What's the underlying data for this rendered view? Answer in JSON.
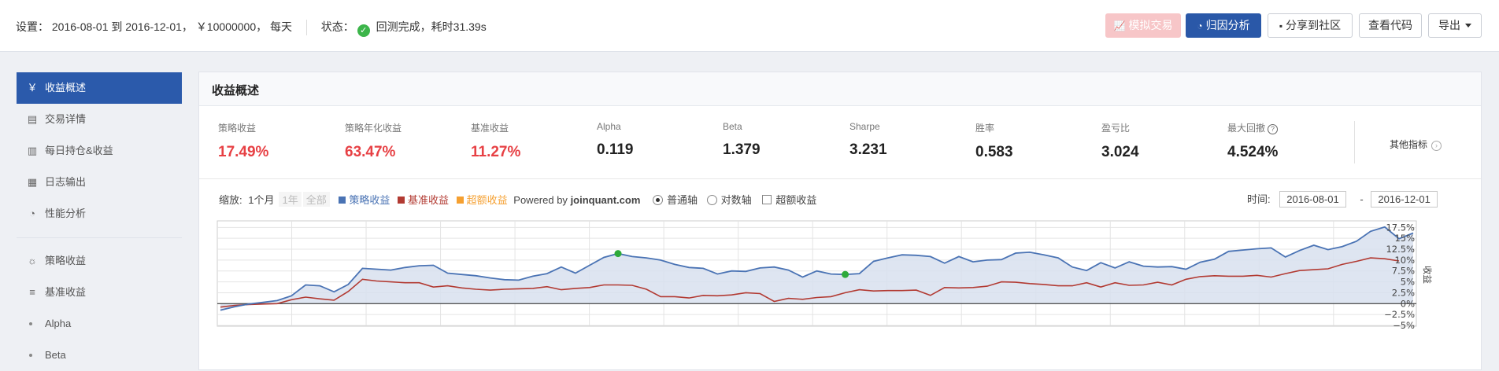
{
  "header": {
    "settings_label": "设置：",
    "start_date": "2016-08-01",
    "to_text": "到",
    "end_date": "2016-12-01",
    "capital": "￥10000000",
    "frequency": "每天",
    "status_label": "状态：",
    "status_text": "回测完成，耗时31.39s",
    "buttons": {
      "simulate": "模拟交易",
      "attribution": "归因分析",
      "share": "分享到社区",
      "view_code": "查看代码",
      "export": "导出"
    }
  },
  "sidebar": {
    "items": [
      {
        "label": "收益概述",
        "icon": "yen-icon"
      },
      {
        "label": "交易详情",
        "icon": "document-icon"
      },
      {
        "label": "每日持仓&收益",
        "icon": "bar-chart-icon"
      },
      {
        "label": "日志输出",
        "icon": "calendar-icon"
      },
      {
        "label": "性能分析",
        "icon": "pie-chart-icon"
      },
      {
        "label": "策略收益",
        "icon": "lightbulb-icon"
      },
      {
        "label": "基准收益",
        "icon": "database-icon"
      },
      {
        "label": "Alpha"
      },
      {
        "label": "Beta"
      }
    ]
  },
  "main": {
    "title": "收益概述",
    "metrics": [
      {
        "label": "策略收益",
        "value": "17.49%"
      },
      {
        "label": "策略年化收益",
        "value": "63.47%"
      },
      {
        "label": "基准收益",
        "value": "11.27%"
      },
      {
        "label": "Alpha",
        "value": "0.119"
      },
      {
        "label": "Beta",
        "value": "1.379"
      },
      {
        "label": "Sharpe",
        "value": "3.231"
      },
      {
        "label": "胜率",
        "value": "0.583"
      },
      {
        "label": "盈亏比",
        "value": "3.024"
      },
      {
        "label": "最大回撤",
        "value": "4.524%",
        "help": "?"
      }
    ],
    "other_metrics": "其他指标",
    "controls": {
      "zoom_label": "缩放:",
      "zoom_options": [
        "1个月",
        "1年",
        "全部"
      ],
      "legend": [
        "策略收益",
        "基准收益",
        "超额收益"
      ],
      "powered_by": "Powered by",
      "brand": "joinquant.com",
      "axis_options": [
        "普通轴",
        "对数轴"
      ],
      "excess_checkbox": "超额收益",
      "time_label": "时间:",
      "date_from": "2016-08-01",
      "date_sep": "-",
      "date_to": "2016-12-01"
    },
    "colors": {
      "strategy": "#4a73b4",
      "benchmark": "#b23a32",
      "excess": "#f5a031",
      "area": "#d8e0ee",
      "accent": "#2b5aab",
      "positive": "#e74044"
    }
  },
  "chart_data": {
    "type": "line",
    "y_axis_side": "right",
    "ylabel": "收益",
    "ylim": [
      -5,
      19
    ],
    "y_ticks": [
      "17.5%",
      "15%",
      "12.5%",
      "10%",
      "7.5%",
      "5%",
      "2.5%",
      "0%",
      "−2.5%",
      "−5%"
    ],
    "y_tick_values": [
      17.5,
      15,
      12.5,
      10,
      7.5,
      5,
      2.5,
      0,
      -2.5,
      -5
    ],
    "series": [
      {
        "name": "策略收益",
        "values": [
          -1.5,
          -0.7,
          -0.1,
          0.3,
          0.7,
          1.8,
          4.3,
          4.1,
          2.7,
          4.4,
          8.1,
          7.9,
          7.7,
          8.3,
          8.7,
          8.8,
          7.0,
          6.7,
          6.4,
          5.9,
          5.5,
          5.4,
          6.3,
          6.9,
          8.4,
          7.0,
          8.8,
          10.6,
          11.5,
          10.8,
          10.5,
          10.0,
          9.0,
          8.3,
          8.1,
          6.8,
          7.5,
          7.4,
          8.2,
          8.4,
          7.7,
          6.1,
          7.5,
          6.8,
          6.7,
          6.9,
          9.7,
          10.5,
          11.2,
          11.1,
          10.8,
          9.3,
          10.8,
          9.6,
          10.0,
          10.1,
          11.6,
          11.8,
          11.2,
          10.5,
          8.4,
          7.6,
          9.4,
          8.2,
          9.6,
          8.6,
          8.4,
          8.5,
          7.9,
          9.5,
          10.2,
          12.0,
          12.3,
          12.6,
          12.8,
          10.7,
          12.2,
          13.4,
          12.4,
          13.1,
          14.3,
          16.6,
          17.6,
          14.9,
          16.2
        ]
      },
      {
        "name": "基准收益",
        "values": [
          -0.8,
          -0.4,
          -0.2,
          -0.1,
          0.0,
          0.9,
          1.5,
          1.1,
          0.8,
          2.8,
          5.6,
          5.2,
          5.0,
          4.8,
          4.8,
          3.8,
          4.1,
          3.6,
          3.3,
          3.1,
          3.3,
          3.4,
          3.5,
          3.9,
          3.2,
          3.5,
          3.7,
          4.3,
          4.3,
          4.2,
          3.3,
          1.6,
          1.6,
          1.3,
          1.9,
          1.8,
          2.0,
          2.5,
          2.3,
          0.5,
          1.2,
          1.0,
          1.4,
          1.6,
          2.5,
          3.2,
          2.9,
          3.0,
          3.0,
          3.1,
          1.9,
          3.7,
          3.6,
          3.7,
          4.0,
          5.0,
          4.9,
          4.6,
          4.4,
          4.1,
          4.1,
          4.8,
          3.8,
          4.8,
          4.2,
          4.3,
          4.9,
          4.3,
          5.6,
          6.2,
          6.4,
          6.3,
          6.3,
          6.5,
          6.1,
          6.9,
          7.6,
          7.8,
          8.0,
          9.0,
          9.7,
          10.5,
          10.3,
          9.8
        ]
      }
    ],
    "markers": [
      {
        "series": "策略收益",
        "index": 28,
        "value": 11.5
      },
      {
        "series": "策略收益",
        "index": 44,
        "value": 6.7
      }
    ],
    "grid": true,
    "area_fill": "策略收益"
  }
}
